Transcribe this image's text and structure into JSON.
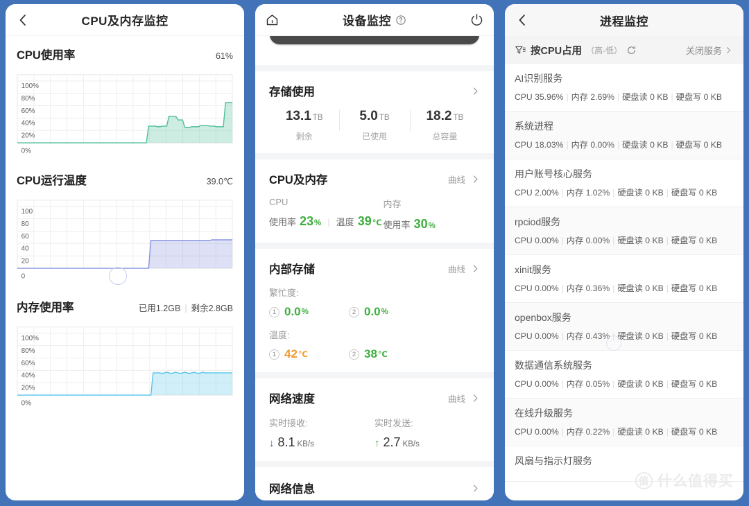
{
  "left": {
    "header": {
      "title": "CPU及内存监控",
      "back_icon": "chevron-left-icon"
    },
    "sections": [
      {
        "title": "CPU使用率",
        "value": "61%",
        "y_ticks": [
          "100%",
          "80%",
          "60%",
          "40%",
          "20%",
          "0%"
        ]
      },
      {
        "title": "CPU运行温度",
        "value": "39.0℃",
        "y_ticks": [
          "100",
          "80",
          "60",
          "40",
          "20",
          "0"
        ]
      },
      {
        "title": "内存使用率",
        "value_used": "已用1.2GB",
        "value_free": "剩余2.8GB",
        "y_ticks": [
          "100%",
          "80%",
          "60%",
          "40%",
          "20%",
          "0%"
        ]
      }
    ]
  },
  "middle": {
    "header": {
      "title": "设备监控",
      "home_icon": "home-icon",
      "help_icon": "question-circle-icon",
      "power_icon": "power-icon"
    },
    "storage": {
      "title": "存储使用",
      "chevron": "chevron-right-icon",
      "cells": [
        {
          "num": "13.1",
          "unit": "TB",
          "label": "剩余"
        },
        {
          "num": "5.0",
          "unit": "TB",
          "label": "已使用"
        },
        {
          "num": "18.2",
          "unit": "TB",
          "label": "总容量"
        }
      ]
    },
    "cpu_mem": {
      "title": "CPU及内存",
      "curve_label": "曲线",
      "cpu_head": "CPU",
      "mem_head": "内存",
      "cpu_usage_label": "使用率",
      "cpu_usage_value": "23",
      "cpu_usage_unit": "%",
      "cpu_temp_label": "温度",
      "cpu_temp_value": "39",
      "cpu_temp_unit": "℃",
      "mem_usage_label": "使用率",
      "mem_usage_value": "30",
      "mem_usage_unit": "%"
    },
    "internal_storage": {
      "title": "内部存储",
      "curve_label": "曲线",
      "busy_label": "繁忙度:",
      "busy": [
        {
          "idx": "1",
          "value": "0.0",
          "unit": "%"
        },
        {
          "idx": "2",
          "value": "0.0",
          "unit": "%"
        }
      ],
      "temp_label": "温度:",
      "temps": [
        {
          "idx": "1",
          "value": "42",
          "unit": "℃"
        },
        {
          "idx": "2",
          "value": "38",
          "unit": "℃"
        }
      ]
    },
    "network_speed": {
      "title": "网络速度",
      "curve_label": "曲线",
      "rx_label": "实时接收:",
      "rx_arrow": "↓",
      "rx_value": "8.1",
      "rx_unit": "KB/s",
      "tx_label": "实时发送:",
      "tx_arrow": "↑",
      "tx_value": "2.7",
      "tx_unit": "KB/s"
    },
    "network_info": {
      "title": "网络信息",
      "chevron": "chevron-right-icon"
    }
  },
  "right": {
    "header": {
      "title": "进程监控",
      "back_icon": "chevron-left-icon"
    },
    "filter": {
      "icon": "filter-sort-icon",
      "label": "按CPU占用",
      "order": "（高-低）",
      "refresh_icon": "refresh-icon",
      "close_label": "关闭服务",
      "close_chevron": "chevron-right-icon"
    },
    "stat_labels": {
      "cpu": "CPU",
      "mem": "内存",
      "read": "硬盘读",
      "write": "硬盘写"
    },
    "processes": [
      {
        "name": "AI识别服务",
        "cpu": "35.96%",
        "mem": "2.69%",
        "read": "0 KB",
        "write": "0 KB"
      },
      {
        "name": "系统进程",
        "cpu": "18.03%",
        "mem": "0.00%",
        "read": "0 KB",
        "write": "0 KB"
      },
      {
        "name": "用户账号核心服务",
        "cpu": "2.00%",
        "mem": "1.02%",
        "read": "0 KB",
        "write": "0 KB"
      },
      {
        "name": "rpciod服务",
        "cpu": "0.00%",
        "mem": "0.00%",
        "read": "0 KB",
        "write": "0 KB"
      },
      {
        "name": "xinit服务",
        "cpu": "0.00%",
        "mem": "0.36%",
        "read": "0 KB",
        "write": "0 KB"
      },
      {
        "name": "openbox服务",
        "cpu": "0.00%",
        "mem": "0.43%",
        "read": "0 KB",
        "write": "0 KB"
      },
      {
        "name": "数据通信系统服务",
        "cpu": "0.00%",
        "mem": "0.05%",
        "read": "0 KB",
        "write": "0 KB"
      },
      {
        "name": "在线升级服务",
        "cpu": "0.00%",
        "mem": "0.22%",
        "read": "0 KB",
        "write": "0 KB"
      },
      {
        "name": "风扇与指示灯服务",
        "cpu": "",
        "mem": "",
        "read": "",
        "write": ""
      }
    ],
    "watermark": {
      "mark": "值",
      "text": "什么值得买"
    }
  },
  "colors": {
    "page_bg": "#4272b8",
    "cpu_line": "#4fbf96",
    "cpu_fill": "#cdeedf",
    "temp_line": "#8795e0",
    "temp_fill": "#e4e7fa",
    "mem_line": "#57c4e8",
    "mem_fill": "#cfeefa",
    "green_value": "#3fae3f",
    "orange_value": "#f29a2e",
    "download_blue": "#2f5fd0",
    "upload_green": "#34a83c"
  },
  "chart_data": [
    {
      "type": "area",
      "title": "CPU使用率",
      "ylabel": "",
      "xlabel": "",
      "ylim": [
        0,
        110
      ],
      "y_ticks": [
        0,
        20,
        40,
        60,
        80,
        100
      ],
      "grid": true,
      "current_value": 61,
      "unit": "%",
      "series": [
        {
          "name": "CPU使用率",
          "color": "#4fbf96",
          "values": [
            0,
            0,
            0,
            0,
            0,
            0,
            0,
            0,
            0,
            0,
            0,
            0,
            0,
            0,
            0,
            0,
            0,
            0,
            0,
            0,
            0,
            0,
            0,
            0,
            0,
            0,
            0,
            0,
            0,
            0,
            0,
            0,
            0,
            0,
            0,
            0,
            0,
            0,
            0,
            0,
            0,
            0,
            0,
            0,
            0,
            0,
            0,
            0,
            0,
            0,
            0,
            0,
            0,
            0,
            0,
            0,
            0,
            0,
            27,
            27,
            27,
            27,
            26,
            26,
            27,
            27,
            27,
            43,
            43,
            43,
            43,
            37,
            37,
            37,
            25,
            25,
            25,
            26,
            26,
            26,
            26,
            28,
            28,
            28,
            28,
            27,
            27,
            27,
            26,
            26,
            26,
            26,
            65,
            65,
            65,
            65
          ]
        }
      ]
    },
    {
      "type": "area",
      "title": "CPU运行温度",
      "ylabel": "",
      "xlabel": "",
      "ylim": [
        0,
        110
      ],
      "y_ticks": [
        0,
        20,
        40,
        60,
        80,
        100
      ],
      "grid": true,
      "current_value": 39.0,
      "unit": "℃",
      "series": [
        {
          "name": "CPU运行温度",
          "color": "#8795e0",
          "values": [
            0,
            0,
            0,
            0,
            0,
            0,
            0,
            0,
            0,
            0,
            0,
            0,
            0,
            0,
            0,
            0,
            0,
            0,
            0,
            0,
            0,
            0,
            0,
            0,
            0,
            0,
            0,
            0,
            0,
            0,
            0,
            0,
            0,
            0,
            0,
            0,
            0,
            0,
            0,
            0,
            0,
            0,
            0,
            0,
            0,
            0,
            0,
            0,
            0,
            0,
            0,
            0,
            0,
            0,
            0,
            0,
            0,
            0,
            0,
            45,
            45,
            45,
            45,
            45,
            45,
            45,
            45,
            45,
            45,
            45,
            45,
            45,
            45,
            45,
            45,
            45,
            45,
            45,
            45,
            45,
            45,
            45,
            45,
            45,
            45,
            45,
            46,
            46,
            46,
            46,
            46,
            46,
            46,
            46,
            46,
            46
          ]
        }
      ]
    },
    {
      "type": "area",
      "title": "内存使用率",
      "ylabel": "",
      "xlabel": "",
      "ylim": [
        0,
        110
      ],
      "y_ticks": [
        0,
        20,
        40,
        60,
        80,
        100
      ],
      "grid": true,
      "used": "已用1.2GB",
      "free": "剩余2.8GB",
      "unit": "%",
      "series": [
        {
          "name": "内存使用率",
          "color": "#57c4e8",
          "values": [
            0,
            0,
            0,
            0,
            0,
            0,
            0,
            0,
            0,
            0,
            0,
            0,
            0,
            0,
            0,
            0,
            0,
            0,
            0,
            0,
            0,
            0,
            0,
            0,
            0,
            0,
            0,
            0,
            0,
            0,
            0,
            0,
            0,
            0,
            0,
            0,
            0,
            0,
            0,
            0,
            0,
            0,
            0,
            0,
            0,
            0,
            0,
            0,
            0,
            0,
            0,
            0,
            0,
            0,
            0,
            0,
            0,
            0,
            0,
            0,
            36,
            36,
            36,
            36,
            35,
            36,
            37,
            36,
            35,
            36,
            37,
            36,
            35,
            36,
            37,
            36,
            35,
            36,
            37,
            36,
            35,
            36,
            37,
            36,
            36,
            36,
            36,
            36,
            36,
            36,
            36,
            36,
            36,
            36,
            36,
            36
          ]
        }
      ]
    }
  ]
}
